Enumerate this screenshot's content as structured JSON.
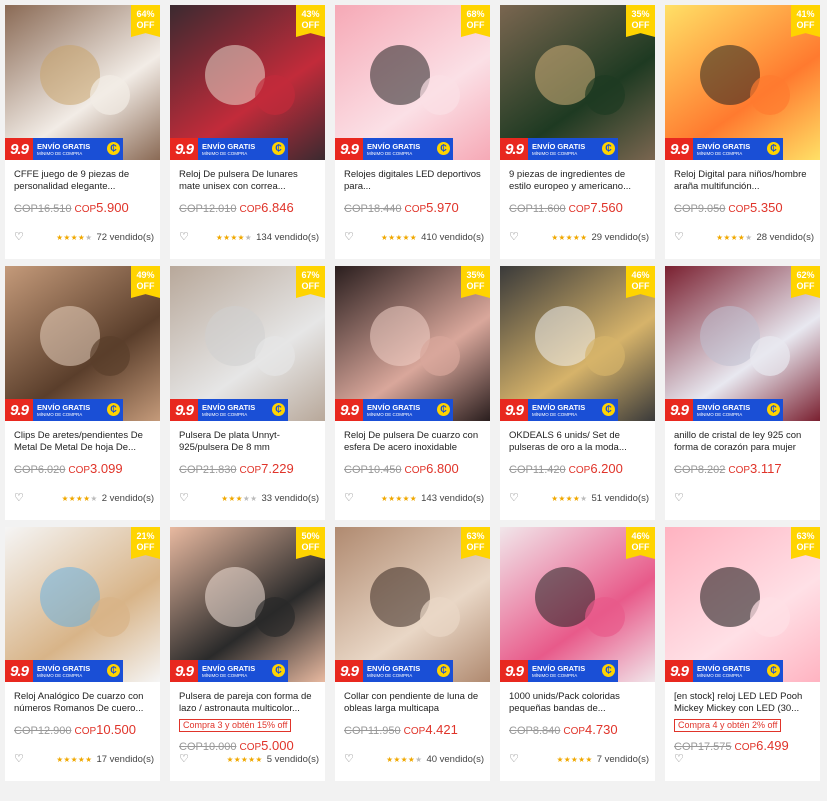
{
  "colors": {
    "accent": "#e0342a",
    "discount": "#ffd400",
    "shipping": "#1a4fd6",
    "nine": "#e8281f",
    "star": "#f0a800"
  },
  "badge": {
    "nine_nine": "9.9",
    "shipping_line1": "ENVÍO GRATIS",
    "shipping_line2": "MÍNIMO DE COMPRA"
  },
  "currency_label": "COP",
  "heart_icon": "heart-icon",
  "products": [
    {
      "discount": "64%\nOFF",
      "title": "CFFE juego de 9 piezas de personalidad elegante...",
      "old_price": "COP16.510",
      "price": "5.900",
      "stars": 4,
      "sold": "72 vendido(s)",
      "promo": ""
    },
    {
      "discount": "43%\nOFF",
      "title": "Reloj De pulsera De lunares mate unisex con correa...",
      "old_price": "COP12.010",
      "price": "6.846",
      "stars": 4,
      "sold": "134 vendido(s)",
      "promo": ""
    },
    {
      "discount": "68%\nOFF",
      "title": "Relojes digitales LED deportivos para...",
      "old_price": "COP18.440",
      "price": "5.970",
      "stars": 5,
      "sold": "410 vendido(s)",
      "promo": ""
    },
    {
      "discount": "35%\nOFF",
      "title": "9 piezas de ingredientes de estilo europeo y americano...",
      "old_price": "COP11.600",
      "price": "7.560",
      "stars": 5,
      "sold": "29 vendido(s)",
      "promo": ""
    },
    {
      "discount": "41%\nOFF",
      "title": "Reloj Digital para niños/hombre araña multifunción...",
      "old_price": "COP9.050",
      "price": "5.350",
      "stars": 4,
      "sold": "28 vendido(s)",
      "promo": ""
    },
    {
      "discount": "49%\nOFF",
      "title": "Clips De aretes/pendientes De Metal De Metal De hoja De...",
      "old_price": "COP6.020",
      "price": "3.099",
      "stars": 4,
      "sold": "2 vendido(s)",
      "promo": ""
    },
    {
      "discount": "67%\nOFF",
      "title": "Pulsera De plata Unnyt-925/pulsera De 8 mm",
      "old_price": "COP21.830",
      "price": "7.229",
      "stars": 3,
      "sold": "33 vendido(s)",
      "promo": ""
    },
    {
      "discount": "35%\nOFF",
      "title": "Reloj De pulsera De cuarzo con esfera De acero inoxidable",
      "old_price": "COP10.450",
      "price": "6.800",
      "stars": 5,
      "sold": "143 vendido(s)",
      "promo": ""
    },
    {
      "discount": "46%\nOFF",
      "title": "OKDEALS 6 unids/ Set de pulseras de oro a la moda...",
      "old_price": "COP11.420",
      "price": "6.200",
      "stars": 4,
      "sold": "51 vendido(s)",
      "promo": ""
    },
    {
      "discount": "62%\nOFF",
      "title": "anillo de cristal de ley 925 con forma de corazón para mujer",
      "old_price": "COP8.202",
      "price": "3.117",
      "stars": 0,
      "sold": "",
      "promo": ""
    },
    {
      "discount": "21%\nOFF",
      "title": "Reloj Analógico De cuarzo con números Romanos De cuero...",
      "old_price": "COP12.900",
      "price": "10.500",
      "stars": 5,
      "sold": "17 vendido(s)",
      "promo": ""
    },
    {
      "discount": "50%\nOFF",
      "title": "Pulsera de pareja con forma de lazo / astronauta multicolor...",
      "old_price": "COP10.000",
      "price": "5.000",
      "stars": 5,
      "sold": "5 vendido(s)",
      "promo": "Compra 3 y obtén 15% off"
    },
    {
      "discount": "63%\nOFF",
      "title": "Collar con pendiente de luna de obleas larga multicapa",
      "old_price": "COP11.950",
      "price": "4.421",
      "stars": 4,
      "sold": "40 vendido(s)",
      "promo": ""
    },
    {
      "discount": "46%\nOFF",
      "title": "1000 unids/Pack coloridas pequeñas bandas de...",
      "old_price": "COP8.840",
      "price": "4.730",
      "stars": 5,
      "sold": "7 vendido(s)",
      "promo": ""
    },
    {
      "discount": "63%\nOFF",
      "title": "[en stock] reloj LED LED Pooh Mickey Mickey con LED (30...",
      "old_price": "COP17.575",
      "price": "6.499",
      "stars": 0,
      "sold": "",
      "promo": "Compra 4 y obtén 2% off"
    }
  ]
}
